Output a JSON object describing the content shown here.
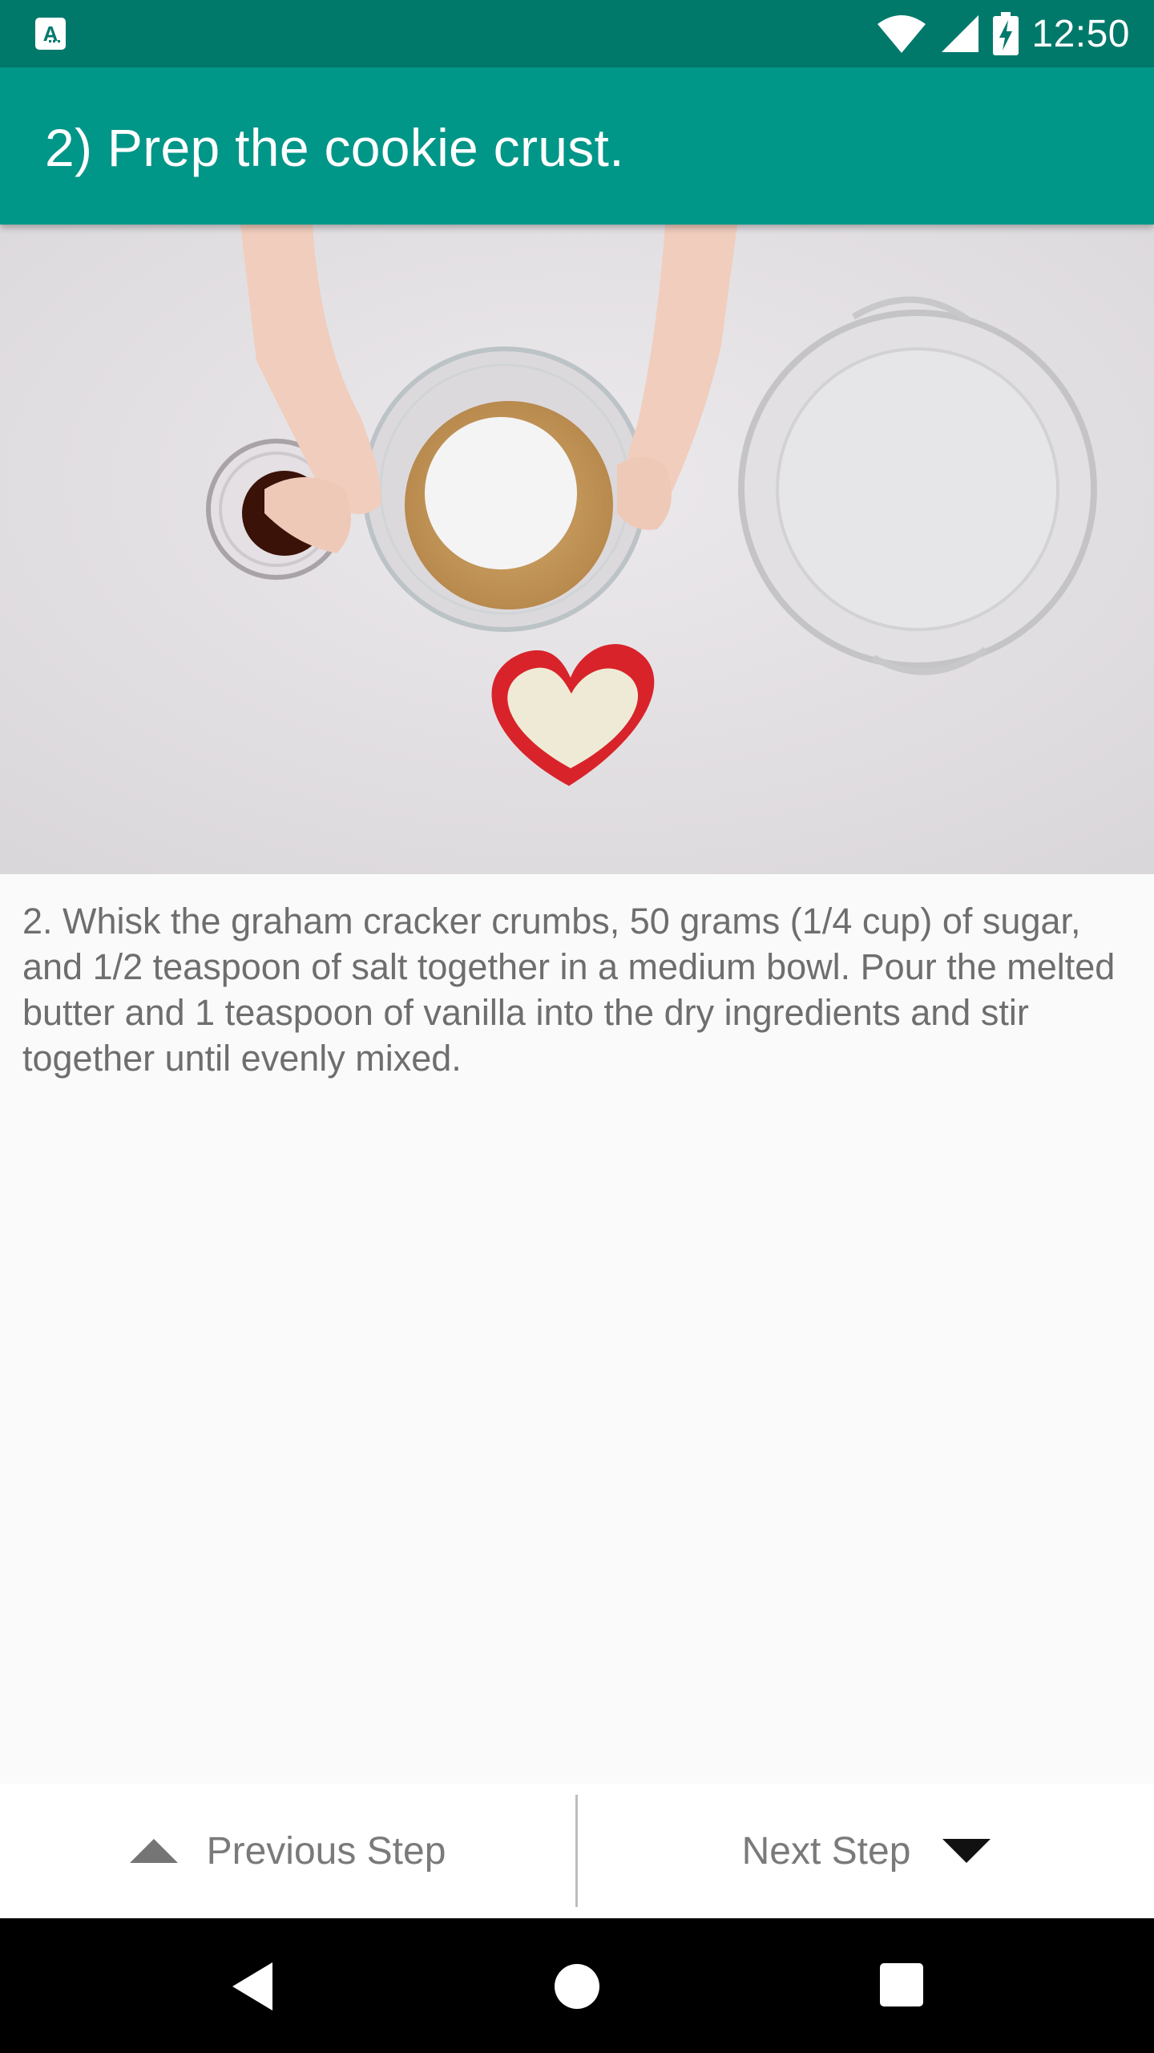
{
  "status_bar": {
    "time": "12:50",
    "app_icon_letter": "A",
    "icons": [
      "wifi-icon",
      "cell-signal-icon",
      "battery-charging-icon"
    ]
  },
  "app_bar": {
    "title": "2) Prep the cookie crust.",
    "color": "#009688"
  },
  "step": {
    "description": "2. Whisk the graham cracker crumbs, 50 grams (1/4 cup) of sugar, and 1/2 teaspoon of salt together in a medium bowl. Pour the melted butter and 1 teaspoon of vanilla into the dry ingredients and stir together until evenly mixed."
  },
  "navigation": {
    "previous_label": "Previous Step",
    "next_label": "Next Step",
    "previous_icon": "triangle-up-icon",
    "next_icon": "triangle-down-icon"
  },
  "system_nav": {
    "icons": [
      "back-icon",
      "home-icon",
      "recents-icon"
    ]
  },
  "colors": {
    "status_bar": "#00796b",
    "primary": "#009688",
    "text_secondary": "#6e6e6e"
  }
}
